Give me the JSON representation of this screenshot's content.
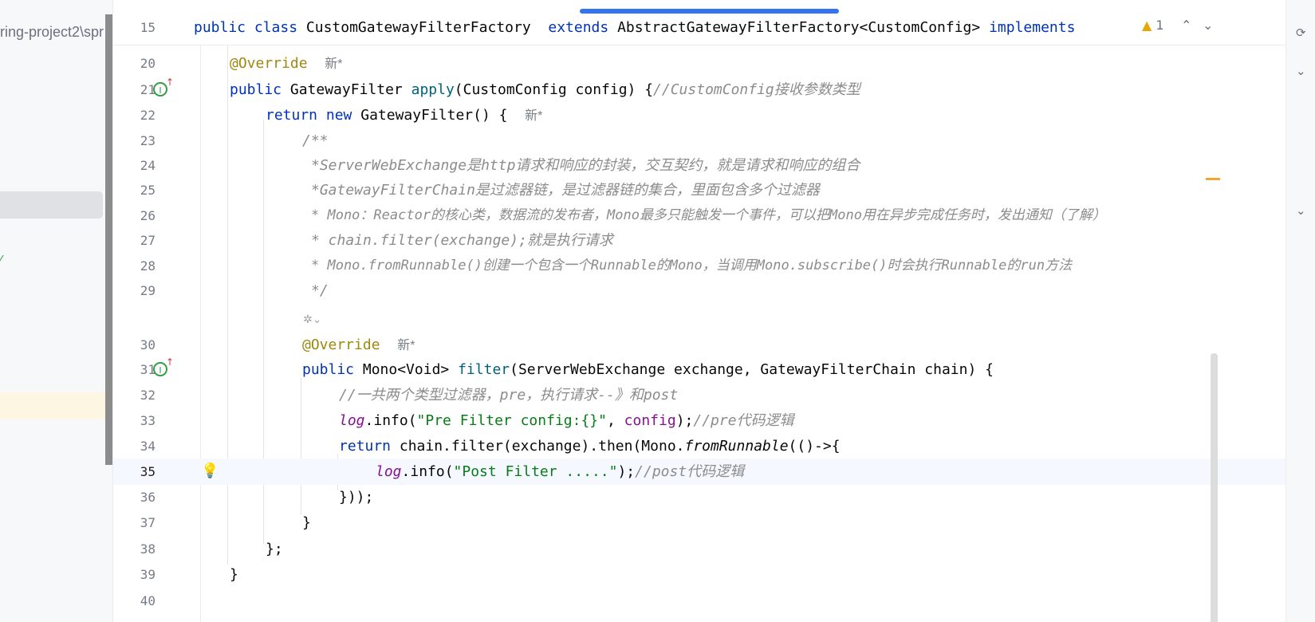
{
  "project_tree": {
    "path_fragment": "ring-project2\\spr"
  },
  "editor": {
    "header": {
      "line_number": "15",
      "kw_public": "public",
      "kw_class": "class",
      "class_name": "CustomGatewayFilterFactory",
      "kw_extends": "extends",
      "superclass": "AbstractGatewayFilterFactory<CustomConfig>",
      "kw_implements": "implements"
    },
    "inspections": {
      "warning_count": "1"
    },
    "badge": "新*",
    "lines": {
      "l20": {
        "num": "20",
        "anno": "@Override"
      },
      "l21": {
        "num": "21",
        "kw": "public",
        "type": "GatewayFilter",
        "method": "apply",
        "params": "(CustomConfig config) {",
        "comment": "//CustomConfig接收参数类型"
      },
      "l22": {
        "num": "22",
        "kw_return": "return",
        "kw_new": "new",
        "rest": "GatewayFilter() {"
      },
      "l23": {
        "num": "23",
        "text": "/**"
      },
      "l24": {
        "num": "24",
        "text": "*ServerWebExchange是http请求和响应的封装，交互契约，就是请求和响应的组合"
      },
      "l25": {
        "num": "25",
        "text": "*GatewayFilterChain是过滤器链，是过滤器链的集合，里面包含多个过滤器"
      },
      "l26": {
        "num": "26",
        "text": "* Mono：Reactor的核心类，数据流的发布者，Mono最多只能触发一个事件，可以把Mono用在异步完成任务时，发出通知（了解）"
      },
      "l27": {
        "num": "27",
        "text": "* chain.filter(exchange);就是执行请求"
      },
      "l28": {
        "num": "28",
        "text": "* Mono.fromRunnable()创建一个包含一个Runnable的Mono，当调用Mono.subscribe()时会执行Runnable的run方法"
      },
      "l29": {
        "num": "29",
        "text": "*/"
      },
      "l30": {
        "num": "30",
        "anno": "@Override"
      },
      "l31": {
        "num": "31",
        "kw": "public",
        "type": "Mono<Void>",
        "method": "filter",
        "params": "(ServerWebExchange exchange, GatewayFilterChain chain) {"
      },
      "l32": {
        "num": "32",
        "comment": "//一共两个类型过滤器，pre，执行请求--》和post"
      },
      "l33": {
        "num": "33",
        "log": "log",
        "call": ".info(",
        "str": "\"Pre Filter config:{}\"",
        "sep": ", ",
        "arg": "config",
        "end": ");",
        "comment": "//pre代码逻辑"
      },
      "l34": {
        "num": "34",
        "kw_return": "return",
        "pre": "chain.filter(exchange).then(Mono.",
        "method": "fromRunnable",
        "post": "(()->{"
      },
      "l35": {
        "num": "35",
        "log": "log",
        "call": ".info(",
        "str": "\"Post Filter .....\"",
        "end": ");",
        "comment": "//post代码逻辑"
      },
      "l36": {
        "num": "36",
        "text": "}));"
      },
      "l37": {
        "num": "37",
        "text": "}"
      },
      "l38": {
        "num": "38",
        "text": "};"
      },
      "l39": {
        "num": "39",
        "text": "}"
      },
      "l40": {
        "num": "40",
        "text": ""
      }
    }
  },
  "colors": {
    "keyword": "#0033b3",
    "annotation": "#9e880d",
    "comment": "#8c8c8c",
    "string": "#067d17",
    "field": "#871094",
    "accent": "#3574f0"
  },
  "icons": [
    "implements-method-icon",
    "ai-assistant-icon",
    "lightbulb-icon",
    "warning-icon",
    "chevron-up-icon",
    "chevron-down-icon",
    "sync-icon"
  ]
}
